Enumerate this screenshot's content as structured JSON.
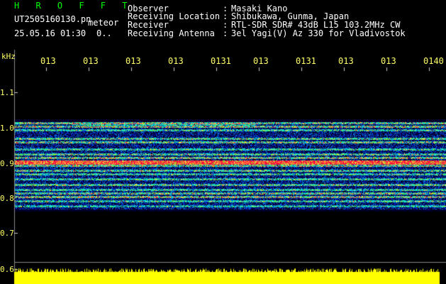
{
  "header": {
    "app_title": "H R O F F T",
    "file_name": "UT2505160130.pn",
    "file_tag": "meteor",
    "date_time": "25.05.16 01:30",
    "status_value": "0.."
  },
  "info": [
    {
      "label": "Observer",
      "value": "Masaki Kano"
    },
    {
      "label": "Receiving Location",
      "value": "Shibukawa, Gunma, Japan"
    },
    {
      "label": "Receiver",
      "value": "RTL-SDR SDR# 43dB L15 103.2MHz CW"
    },
    {
      "label": "Receiving Antenna",
      "value": "3el Yagi(V) Az 330 for Vladivostok"
    }
  ],
  "separator": ":",
  "axis": {
    "unit": "kHz",
    "y_ticks": [
      "1.1",
      "1.0",
      "0.9",
      "0.8",
      "0.7",
      "0.6"
    ],
    "x_ticks": [
      "013",
      "013",
      "013",
      "013",
      "0131",
      "013",
      "0131",
      "013",
      "013",
      "0140"
    ]
  },
  "colors": {
    "background": "#000000",
    "tick_text": "#ffff66",
    "title": "#00ff00",
    "power_trace": "#ffff00"
  }
}
